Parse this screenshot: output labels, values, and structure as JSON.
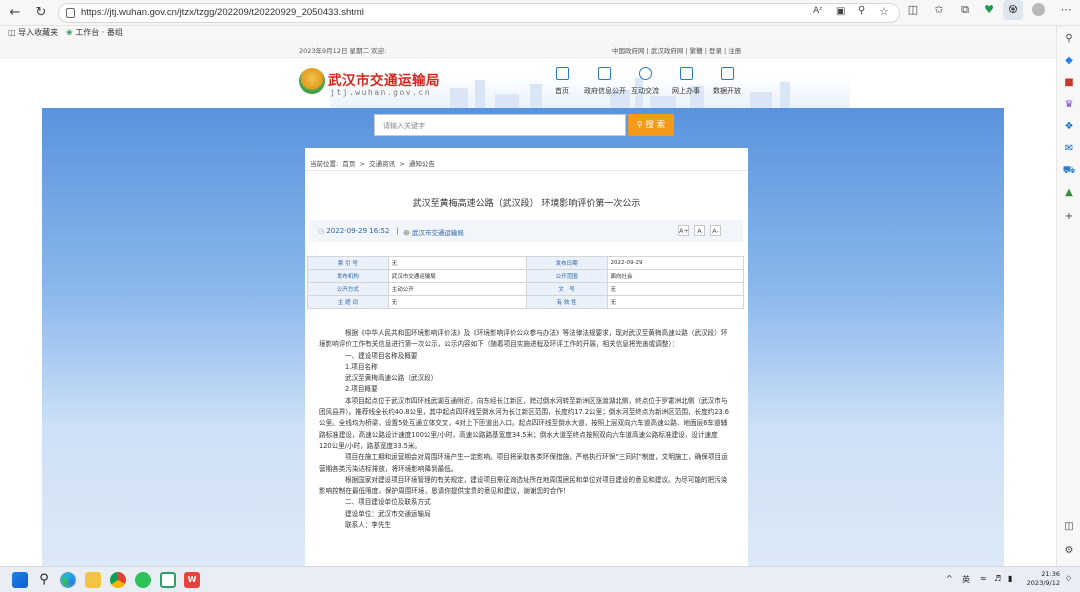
{
  "browser": {
    "url": "https://jtj.wuhan.gov.cn/jtzx/tzgg/202209/t20220929_2050433.shtml",
    "favorites": [
      "导入收藏夹",
      "工作台 · 番组"
    ],
    "address_icons": [
      "read-aloud-icon",
      "reader-view-icon",
      "zoom-icon",
      "favorite-star-icon",
      "split-screen-icon",
      "favorites-icon",
      "collections-icon",
      "browser-essentials-icon",
      "extensions-icon",
      "profile-icon",
      "more-icon"
    ]
  },
  "page": {
    "topbar": {
      "date_greeting": "2023年9月12日 星期二  欢迎:",
      "links": "中国政府网  |  武汉政府网  |  繁體  |  登录  |  注册"
    },
    "site": {
      "title": "武汉市交通运输局",
      "domain": "jtj.wuhan.gov.cn"
    },
    "nav": [
      "首页",
      "政府信息公开",
      "互动交流",
      "网上办事",
      "数据开放"
    ],
    "search": {
      "placeholder": "请输入关键字",
      "button": "搜 索"
    },
    "breadcrumb": {
      "label": "当前位置:",
      "items": [
        "首页",
        "交通资讯",
        "通知公告"
      ],
      "sep": ">"
    },
    "article": {
      "title": "武汉至黄梅高速公路（武汉段） 环境影响评价第一次公示",
      "date": "2022-09-29 16:52",
      "divider": "|",
      "source": "武汉市交通运输局",
      "font_sizes": [
        "A+",
        "A",
        "A-"
      ],
      "info_table": [
        [
          "索 引 号",
          "无",
          "发布日期",
          "2022-09-29"
        ],
        [
          "发布机构",
          "武汉市交通运输局",
          "公开范围",
          "面向社会"
        ],
        [
          "公开方式",
          "主动公开",
          "文　号",
          "无"
        ],
        [
          "主 题 词",
          "无",
          "有 效 性",
          "无"
        ]
      ],
      "paragraphs": [
        "根据《中华人民共和国环境影响评价法》及《环境影响评价公众参与办法》等法律法规要求，现对武汉至黄梅高速公路（武汉段）环境影响评价工作有关信息进行第一次公示，公示内容如下（随着项目实施进程及环评工作的开展，相关信息将完善或调整）：",
        "一、建设项目名称及概要",
        "1.项目名称",
        "武汉至黄梅高速公路（武汉段）",
        "2.项目概要",
        "本项目起点位于武汉市四环线武湖互通附近，向东经长江新区，跨过倒水河转至新洲区涨渡湖北侧，终点位于罗霍洲北侧（武汉市与团风县界）。推荐线全长约40.8公里，其中起点四环线至倒水河为长江新区范围，长度约17.2公里；倒水河至终点为新洲区范围，长度约23.6公里。全线均为桥梁，设置5处互通立体交叉，4对上下匝道出入口。起点四环线至倒水大道，按照上层双向六车道高速公路、地面层6车道辅路标准建设，高速公路设计速度100公里/小时，高速公路路基宽度34.5米；倒水大道至终点按照双向六车道高速公路标准建设，设计速度120公里/小时，路基宽度33.5米。",
        "项目在施工期和运营期会对周围环境产生一定影响。项目将采取各类环保措施，严格执行环保“三同时”制度，文明施工，确保项目运营期各类污染达标排放，将环境影响降到最低。",
        "根据国家对建设项目环境管理的有关规定，建设项目需征询选址所在地周围居民和单位对项目建设的意见和建议。为尽可能的把污染影响控制在最低限度，保护周围环境，恳请你提供宝贵的意见和建议，谢谢您的合作！",
        "二、项目建设单位及联系方式",
        "建设单位：武汉市交通运输局",
        "联系人：李先生"
      ]
    }
  },
  "taskbar": {
    "apps": [
      "windows-start-icon",
      "search-icon",
      "edge-icon",
      "file-explorer-icon",
      "chrome-icon",
      "wechat-icon",
      "screenshot-tool-icon",
      "wps-icon"
    ],
    "tray_chevron": "^",
    "ime": "英",
    "time": "21:36",
    "date": "2023/9/12"
  },
  "colors": {
    "accent_blue": "#2a78c9",
    "title_red": "#d6261c",
    "search_orange": "#f39a1b"
  }
}
